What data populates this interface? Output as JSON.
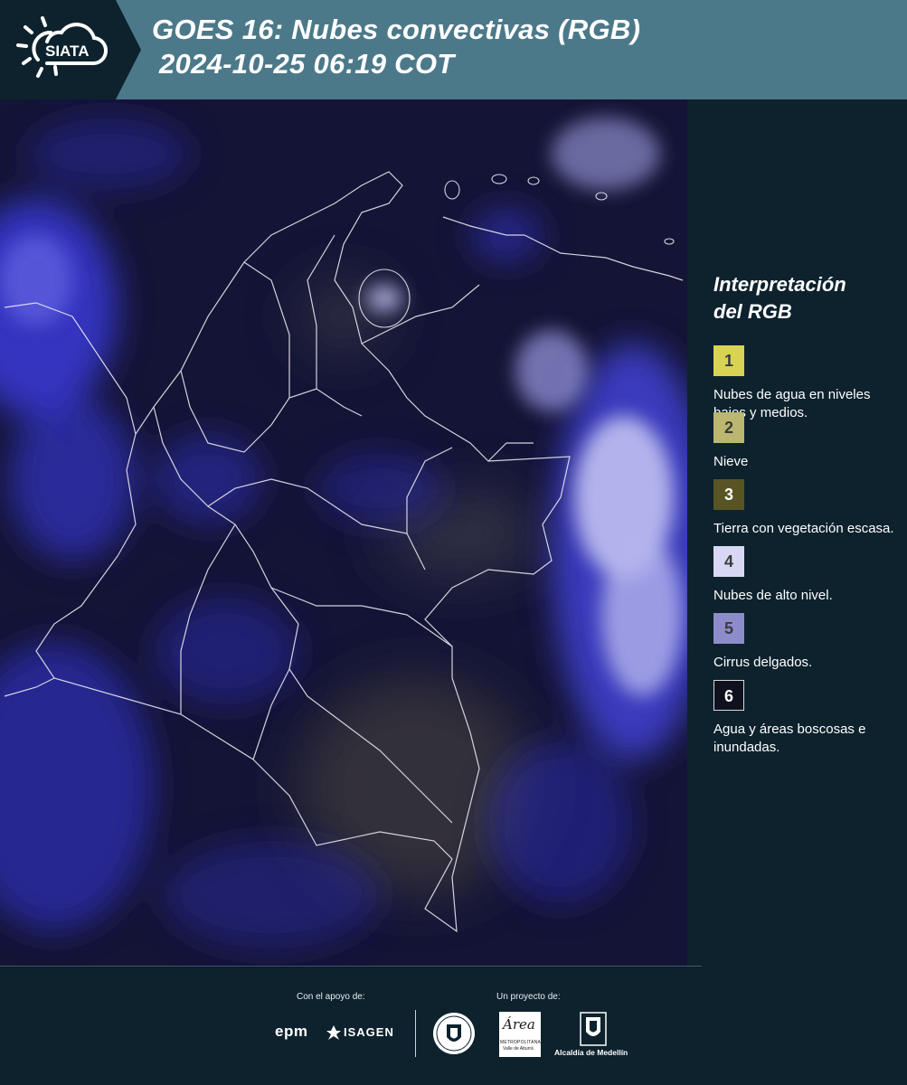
{
  "header": {
    "logo_text": "SIATA",
    "title_line1": "GOES 16: Nubes convectivas (RGB)",
    "title_line2": "2024-10-25 06:19 COT"
  },
  "legend": {
    "title_line1": "Interpretación",
    "title_line2": "del RGB",
    "items": [
      {
        "number": "1",
        "label": "Nubes de agua en niveles bajos y medios.",
        "color": "#d8d352"
      },
      {
        "number": "2",
        "label": "Nieve",
        "color": "#bbb770"
      },
      {
        "number": "3",
        "label": "Tierra con vegetación escasa.",
        "color": "#595423"
      },
      {
        "number": "4",
        "label": "Nubes de alto nivel.",
        "color": "#d8d8f4"
      },
      {
        "number": "5",
        "label": "Cirrus delgados.",
        "color": "#8d8ccb"
      },
      {
        "number": "6",
        "label": "Agua y áreas boscosas e inundadas.",
        "color": "#10111f"
      }
    ]
  },
  "footer": {
    "support_label": "Con el apoyo de:",
    "project_label": "Un proyecto de:",
    "sponsors": [
      "epm",
      "ISAGEN"
    ],
    "partners": [
      "Área",
      "METROPOLITANA",
      "Valle de Aburrá",
      "Alcaldía de Medellín"
    ]
  },
  "colors": {
    "header_bg": "#4c7989",
    "page_bg": "#0d222d",
    "cloud_blue": "#3a3ad8",
    "cloud_white": "#c8c8f4"
  }
}
